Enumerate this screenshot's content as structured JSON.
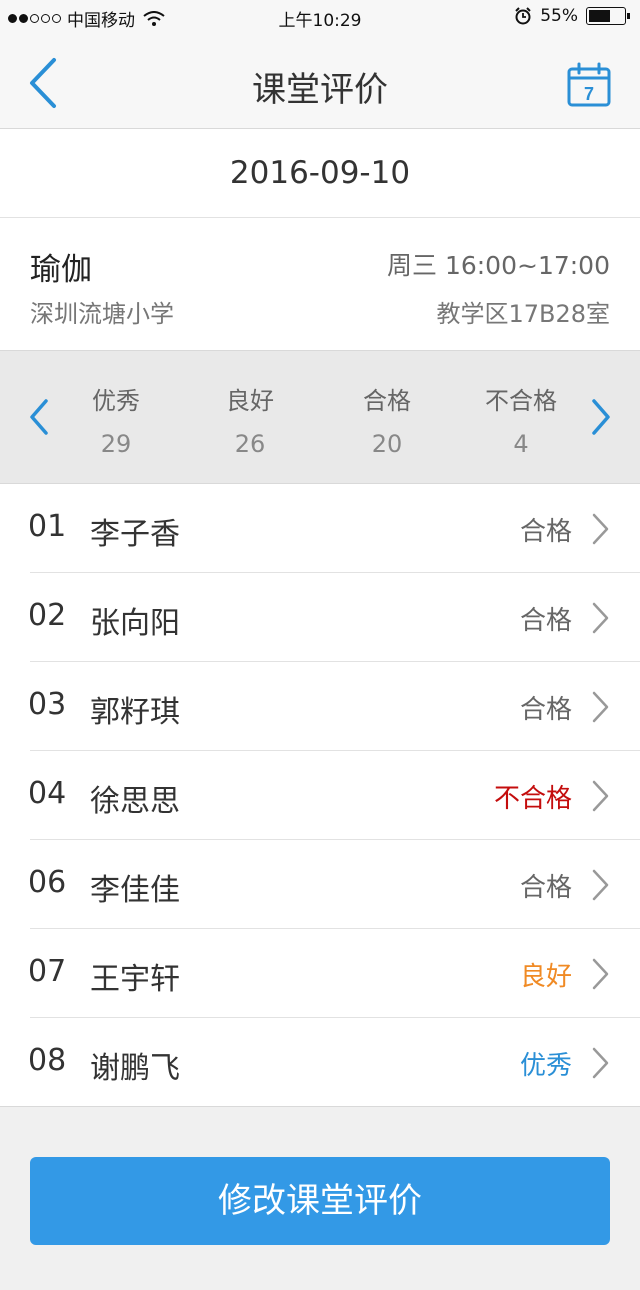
{
  "status_bar": {
    "carrier": "中国移动",
    "time": "上午10:29",
    "battery": "55%"
  },
  "nav": {
    "title": "课堂评价",
    "calendar_day": "7"
  },
  "date": "2016-09-10",
  "course": {
    "name": "瑜伽",
    "school": "深圳流塘小学",
    "time": "周三 16:00~17:00",
    "room": "教学区17B28室"
  },
  "stats": [
    {
      "label": "优秀",
      "count": "29"
    },
    {
      "label": "良好",
      "count": "26"
    },
    {
      "label": "合格",
      "count": "20"
    },
    {
      "label": "不合格",
      "count": "4"
    }
  ],
  "students": [
    {
      "num": "01",
      "name": "李子香",
      "grade": "合格"
    },
    {
      "num": "02",
      "name": "张向阳",
      "grade": "合格"
    },
    {
      "num": "03",
      "name": "郭籽琪",
      "grade": "合格"
    },
    {
      "num": "04",
      "name": "徐思思",
      "grade": "不合格"
    },
    {
      "num": "06",
      "name": "李佳佳",
      "grade": "合格"
    },
    {
      "num": "07",
      "name": "王宇轩",
      "grade": "良好"
    },
    {
      "num": "08",
      "name": "谢鹏飞",
      "grade": "优秀"
    }
  ],
  "grade_colors": {
    "合格": "#666666",
    "不合格": "#c40d0d",
    "良好": "#f08a24",
    "优秀": "#2a8fd6"
  },
  "accent_color": "#3399e6",
  "action_button": "修改课堂评价"
}
